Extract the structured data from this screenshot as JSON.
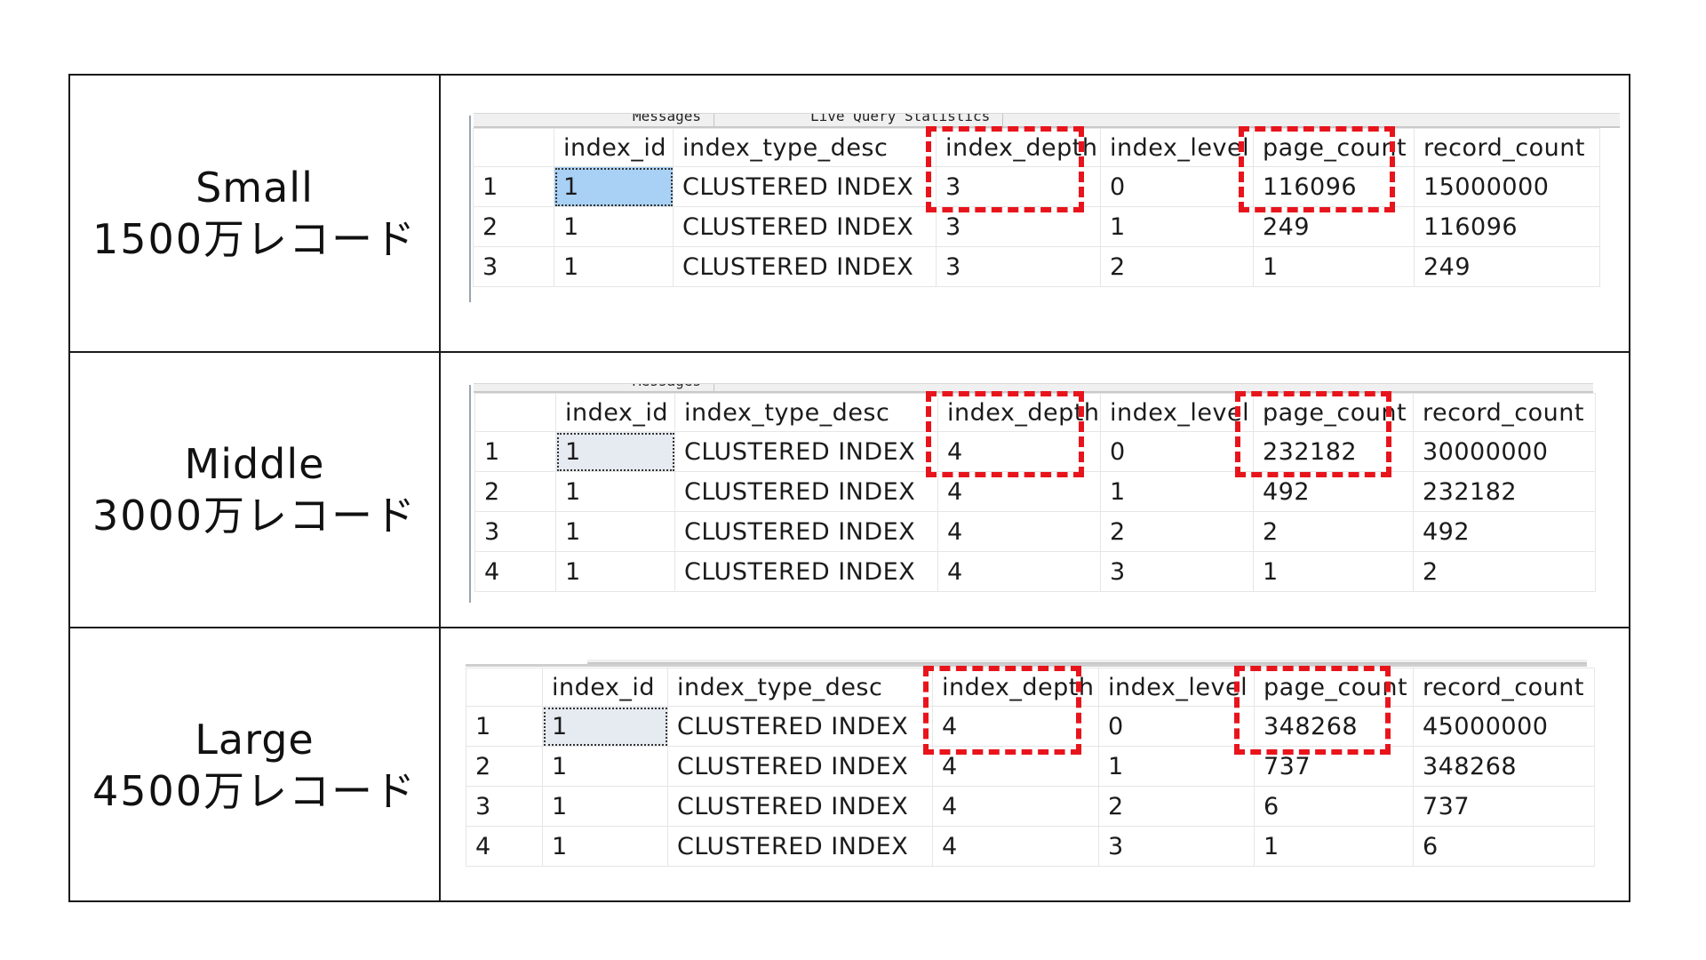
{
  "columns": [
    "",
    "index_id",
    "index_type_desc",
    "index_depth",
    "index_level",
    "page_count",
    "record_count"
  ],
  "highlight_color": "#e8141c",
  "result_tabs": [
    "Messages",
    "Live Query Statistics"
  ],
  "sections": [
    {
      "name": "Small",
      "records_label": "1500万レコード",
      "selected_style": "blue",
      "rows": [
        [
          "1",
          "1",
          "CLUSTERED INDEX",
          "3",
          "0",
          "116096",
          "15000000"
        ],
        [
          "2",
          "1",
          "CLUSTERED INDEX",
          "3",
          "1",
          "249",
          "116096"
        ],
        [
          "3",
          "1",
          "CLUSTERED INDEX",
          "3",
          "2",
          "1",
          "249"
        ]
      ]
    },
    {
      "name": "Middle",
      "records_label": "3000万レコード",
      "selected_style": "gray",
      "rows": [
        [
          "1",
          "1",
          "CLUSTERED INDEX",
          "4",
          "0",
          "232182",
          "30000000"
        ],
        [
          "2",
          "1",
          "CLUSTERED INDEX",
          "4",
          "1",
          "492",
          "232182"
        ],
        [
          "3",
          "1",
          "CLUSTERED INDEX",
          "4",
          "2",
          "2",
          "492"
        ],
        [
          "4",
          "1",
          "CLUSTERED INDEX",
          "4",
          "3",
          "1",
          "2"
        ]
      ]
    },
    {
      "name": "Large",
      "records_label": "4500万レコード",
      "selected_style": "gray",
      "rows": [
        [
          "1",
          "1",
          "CLUSTERED INDEX",
          "4",
          "0",
          "348268",
          "45000000"
        ],
        [
          "2",
          "1",
          "CLUSTERED INDEX",
          "4",
          "1",
          "737",
          "348268"
        ],
        [
          "3",
          "1",
          "CLUSTERED INDEX",
          "4",
          "2",
          "6",
          "737"
        ],
        [
          "4",
          "1",
          "CLUSTERED INDEX",
          "4",
          "3",
          "1",
          "6"
        ]
      ]
    }
  ]
}
